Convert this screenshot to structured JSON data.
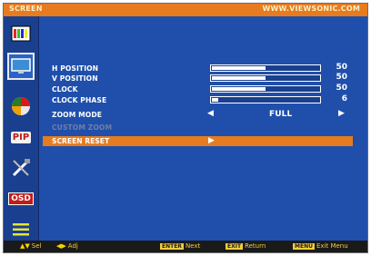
{
  "header": {
    "title": "SCREEN",
    "url": "WWW.VIEWSONIC.COM"
  },
  "sidebar": {
    "tabs": [
      {
        "icon": "color-bars-icon"
      },
      {
        "icon": "monitor-screen-icon",
        "active": true
      },
      {
        "icon": "color-palette-icon"
      },
      {
        "icon": "pip-icon",
        "label": "PIP"
      },
      {
        "icon": "setup-tools-icon"
      },
      {
        "icon": "osd-icon",
        "label": "OSD"
      },
      {
        "icon": "menu-lines-icon"
      }
    ]
  },
  "menu": {
    "items": [
      {
        "label": "H POSITION",
        "value": "50",
        "level": 0.5
      },
      {
        "label": "V POSITION",
        "value": "50",
        "level": 0.5
      },
      {
        "label": "CLOCK",
        "value": "50",
        "level": 0.5
      },
      {
        "label": "CLOCK PHASE",
        "value": "6",
        "level": 0.06
      }
    ],
    "zoom": {
      "label": "ZOOM MODE",
      "left_arrow": "◀",
      "value": "FULL",
      "right_arrow": "▶"
    },
    "disabled_item": {
      "label": "CUSTOM ZOOM"
    },
    "reset": {
      "label": "SCREEN RESET",
      "arrow": "▶"
    }
  },
  "footer": {
    "sel": {
      "key": "▲▼",
      "label": "Sel"
    },
    "adj": {
      "key": "◀▶",
      "label": "Adj"
    },
    "next": {
      "key": "ENTER",
      "label": "Next"
    },
    "ret": {
      "key": "EXIT",
      "label": "Return"
    },
    "exit": {
      "key": "MENU",
      "label": "Exit Menu"
    }
  },
  "colors": {
    "background": "#1f4faa",
    "accent": "#e77b1f",
    "footer": "#1a1a1a"
  }
}
